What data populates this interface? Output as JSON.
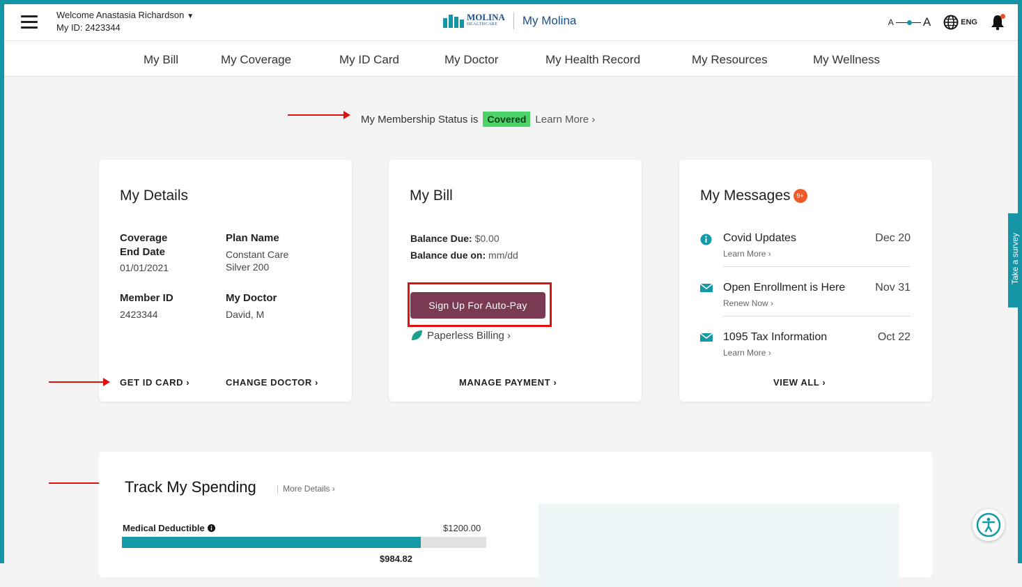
{
  "header": {
    "welcome": "Welcome Anastasia Richardson",
    "member_id_label": "My ID: 2423344",
    "logo_text": "MOLINA",
    "logo_sub": "HEALTHCARE",
    "site_name": "My Molina",
    "font_small": "A",
    "font_large": "A",
    "language": "ENG"
  },
  "nav": {
    "items": [
      {
        "label": "My Bill"
      },
      {
        "label": "My Coverage"
      },
      {
        "label": "My ID Card"
      },
      {
        "label": "My Doctor"
      },
      {
        "label": "My Health Record"
      },
      {
        "label": "My Resources"
      },
      {
        "label": "My Wellness"
      }
    ]
  },
  "membership": {
    "text": "My Membership Status is",
    "status": "Covered",
    "learn_more": "Learn More ›"
  },
  "details": {
    "title": "My Details",
    "coverage_label": "Coverage End Date",
    "coverage_value": "01/01/2021",
    "plan_label": "Plan Name",
    "plan_value": "Constant Care Silver 200",
    "member_label": "Member ID",
    "member_value": "2423344",
    "doctor_label": "My Doctor",
    "doctor_value": "David, M",
    "get_id": "GET ID CARD ›",
    "change_doctor": "CHANGE DOCTOR ›"
  },
  "bill": {
    "title": "My Bill",
    "balance_label": "Balance Due:",
    "balance_value": "$0.00",
    "due_label": "Balance due on:",
    "due_value": "mm/dd",
    "autopay": "Sign Up For Auto-Pay",
    "paperless": "Paperless Billing ›",
    "manage": "MANAGE PAYMENT ›"
  },
  "messages": {
    "title": "My Messages",
    "count": "9+",
    "items": [
      {
        "title": "Covid Updates",
        "sub": "Learn More ›",
        "date": "Dec 20",
        "icon": "info-icon"
      },
      {
        "title": "Open Enrollment is Here",
        "sub": "Renew Now ›",
        "date": "Nov 31",
        "icon": "envelope-icon"
      },
      {
        "title": "1095 Tax Information",
        "sub": "Learn More ›",
        "date": "Oct 22",
        "icon": "envelope-icon"
      }
    ],
    "view_all": "VIEW ALL ›"
  },
  "survey": "Take a survey",
  "spending": {
    "title": "Track My Spending",
    "more": "More Details ›",
    "deductible_label": "Medical Deductible",
    "deductible_total": "$1200.00",
    "deductible_used": "$984.82",
    "deductible_fraction": 0.8207
  },
  "colors": {
    "teal": "#1595a5",
    "status_green": "#4bd36a",
    "autopay": "#7b3a54",
    "badge_orange": "#f05a28",
    "annotation_red": "#e01010"
  }
}
